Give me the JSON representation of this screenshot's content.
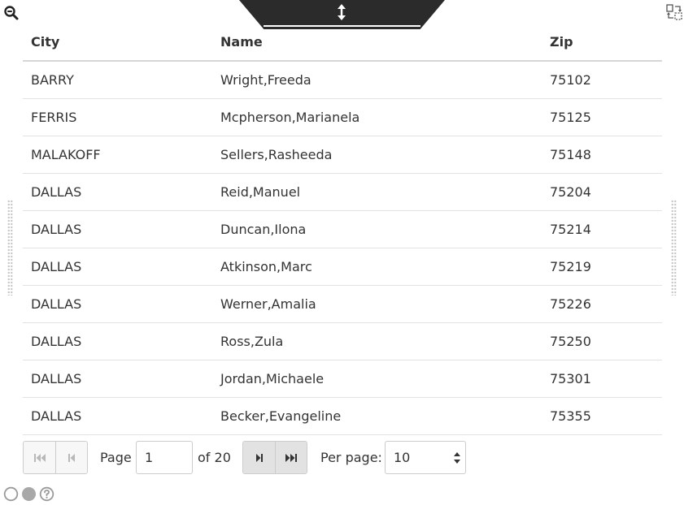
{
  "toolbar": {
    "zoom_icon": "zoom-out-icon",
    "resize_icon": "vertical-resize-icon",
    "swap_icon": "swap-layout-icon"
  },
  "table": {
    "columns": [
      "City",
      "Name",
      "Zip"
    ],
    "rows": [
      {
        "city": "BARRY",
        "name": "Wright,Freeda",
        "zip": "75102"
      },
      {
        "city": "FERRIS",
        "name": "Mcpherson,Marianela",
        "zip": "75125"
      },
      {
        "city": "MALAKOFF",
        "name": "Sellers,Rasheeda",
        "zip": "75148"
      },
      {
        "city": "DALLAS",
        "name": "Reid,Manuel",
        "zip": "75204"
      },
      {
        "city": "DALLAS",
        "name": "Duncan,Ilona",
        "zip": "75214"
      },
      {
        "city": "DALLAS",
        "name": "Atkinson,Marc",
        "zip": "75219"
      },
      {
        "city": "DALLAS",
        "name": "Werner,Amalia",
        "zip": "75226"
      },
      {
        "city": "DALLAS",
        "name": "Ross,Zula",
        "zip": "75250"
      },
      {
        "city": "DALLAS",
        "name": "Jordan,Michaele",
        "zip": "75301"
      },
      {
        "city": "DALLAS",
        "name": "Becker,Evangeline",
        "zip": "75355"
      }
    ]
  },
  "pager": {
    "page_label": "Page",
    "current_page": "1",
    "of_label": "of 20",
    "per_page_label": "Per page:",
    "per_page_value": "10"
  },
  "footer": {
    "icons": [
      "empty-circle-icon",
      "filled-circle-icon",
      "help-icon"
    ]
  },
  "colors": {
    "tab_background": "#2b2b2b",
    "text": "#333333",
    "border": "#cccccc",
    "enabled_button": "#e2e2e2",
    "disabled_button": "#f7f7f7"
  }
}
